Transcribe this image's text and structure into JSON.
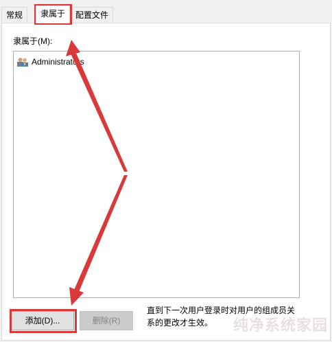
{
  "tabs": [
    {
      "label": "常规",
      "active": false
    },
    {
      "label": "隶属于",
      "active": true
    },
    {
      "label": "配置文件",
      "active": false
    }
  ],
  "member_of": {
    "label": "隶属于(M):",
    "items": [
      {
        "name": "Administrators",
        "icon": "user-group-icon"
      }
    ]
  },
  "buttons": {
    "add_label": "添加(D)...",
    "remove_label": "删除(R)"
  },
  "note": {
    "line1": "直到下一次用户登录时对用户的组成员关",
    "line2": "系的更改才生效。"
  },
  "watermark": "纯净系统家园",
  "colors": {
    "highlight": "#d83a3a",
    "panel_bg": "#ffffff",
    "window_bg": "#f0f0f0"
  }
}
